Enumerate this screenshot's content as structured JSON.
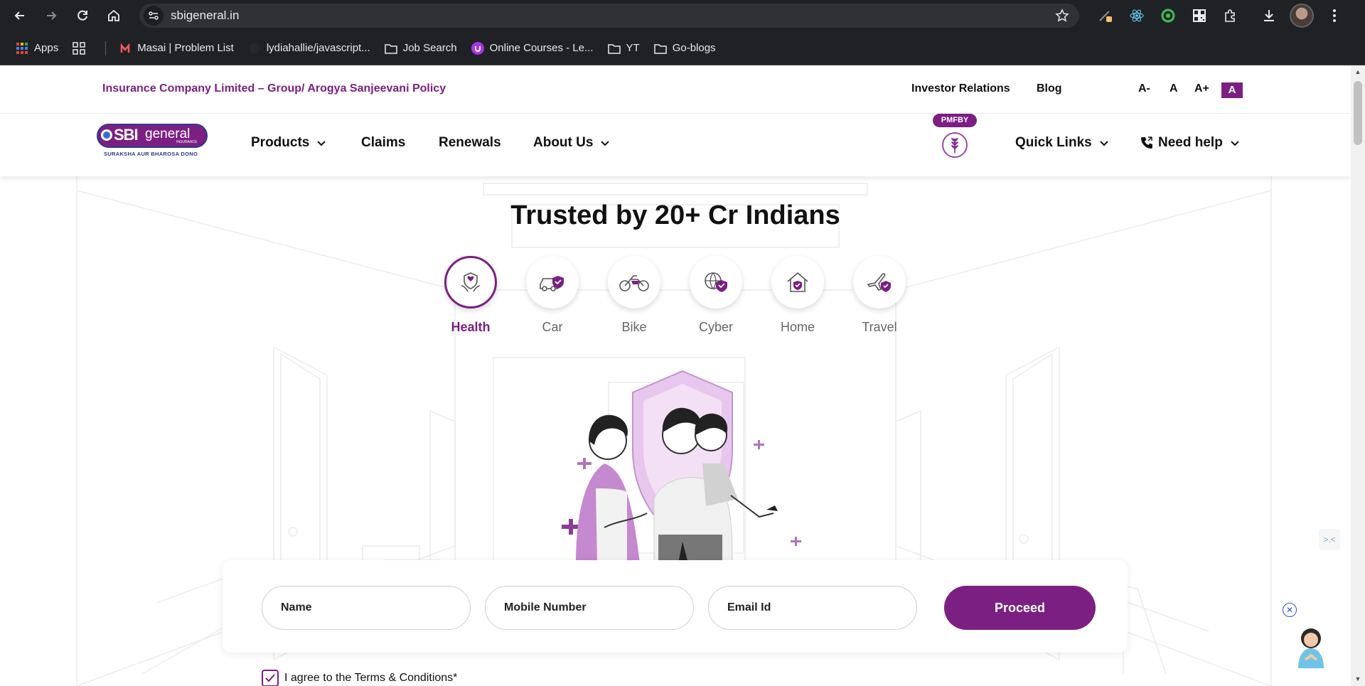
{
  "browser": {
    "url": "sbigeneral.in",
    "bookmarks": [
      {
        "label": "Apps",
        "icon": "apps-grid-icon"
      },
      {
        "label": "",
        "icon": "grid-icon"
      },
      {
        "label": "Masai | Problem List",
        "icon": "masai-icon"
      },
      {
        "label": "lydiahallie/javascript...",
        "icon": "github-icon"
      },
      {
        "label": "Job Search",
        "icon": "folder-icon"
      },
      {
        "label": "Online Courses - Le...",
        "icon": "udemy-icon"
      },
      {
        "label": "YT",
        "icon": "folder-icon"
      },
      {
        "label": "Go-blogs",
        "icon": "folder-icon"
      }
    ]
  },
  "topbar": {
    "ticker": "Insurance Company Limited – Group/ Arogya Sanjeevani Policy",
    "links": [
      "Investor Relations",
      "Blog"
    ],
    "font_controls": [
      "A-",
      "A",
      "A+",
      "A"
    ]
  },
  "logo": {
    "sbi": "SBI",
    "general": "general",
    "insurance": "INSURANCE",
    "tagline": "SURAKSHA AUR BHAROSA DONO"
  },
  "nav": {
    "products": "Products",
    "claims": "Claims",
    "renewals": "Renewals",
    "about": "About Us",
    "pmfby": "PMFBY",
    "quick_links": "Quick Links",
    "need_help": "Need help"
  },
  "hero": {
    "headline": "Trusted by 20+ Cr Indians",
    "categories": [
      {
        "label": "Health",
        "icon": "health-shield-icon",
        "active": true
      },
      {
        "label": "Car",
        "icon": "car-shield-icon",
        "active": false
      },
      {
        "label": "Bike",
        "icon": "bike-icon",
        "active": false
      },
      {
        "label": "Cyber",
        "icon": "cyber-globe-icon",
        "active": false
      },
      {
        "label": "Home",
        "icon": "home-shield-icon",
        "active": false
      },
      {
        "label": "Travel",
        "icon": "plane-shield-icon",
        "active": false
      }
    ]
  },
  "form": {
    "name_placeholder": "Name",
    "mobile_placeholder": "Mobile Number",
    "email_placeholder": "Email Id",
    "proceed": "Proceed",
    "terms": "I agree to the Terms & Conditions*"
  },
  "colors": {
    "brand": "#7b1f83",
    "chrome_bg": "#202124"
  }
}
